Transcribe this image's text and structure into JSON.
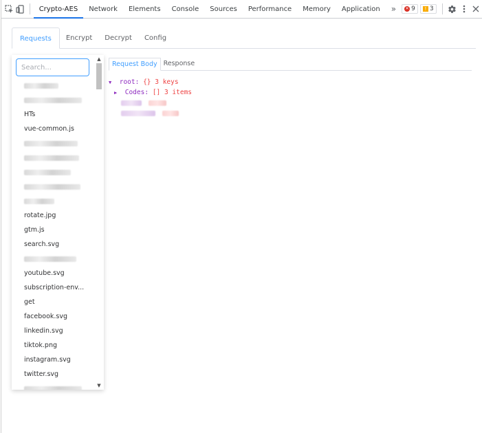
{
  "devtools": {
    "tabs": [
      {
        "label": "Crypto-AES",
        "active": true
      },
      {
        "label": "Network",
        "active": false
      },
      {
        "label": "Elements",
        "active": false
      },
      {
        "label": "Console",
        "active": false
      },
      {
        "label": "Sources",
        "active": false
      },
      {
        "label": "Performance",
        "active": false
      },
      {
        "label": "Memory",
        "active": false
      },
      {
        "label": "Application",
        "active": false
      }
    ],
    "more_tabs": "»",
    "error_count": "9",
    "warning_count": "3"
  },
  "plugin_tabs": [
    {
      "label": "Requests",
      "active": true
    },
    {
      "label": "Encrypt",
      "active": false
    },
    {
      "label": "Decrypt",
      "active": false
    },
    {
      "label": "Config",
      "active": false
    }
  ],
  "search": {
    "placeholder": "Search...",
    "value": ""
  },
  "requests": [
    {
      "label": "",
      "redacted": true
    },
    {
      "label": "",
      "redacted": true
    },
    {
      "label": "HTs",
      "redacted": false
    },
    {
      "label": "vue-common.js",
      "redacted": false
    },
    {
      "label": "",
      "redacted": true
    },
    {
      "label": "",
      "redacted": true
    },
    {
      "label": "",
      "redacted": true
    },
    {
      "label": "",
      "redacted": true
    },
    {
      "label": "",
      "redacted": true
    },
    {
      "label": "rotate.jpg",
      "redacted": false
    },
    {
      "label": "gtm.js",
      "redacted": false
    },
    {
      "label": "search.svg",
      "redacted": false
    },
    {
      "label": "",
      "redacted": true
    },
    {
      "label": "youtube.svg",
      "redacted": false
    },
    {
      "label": "subscription-env...",
      "redacted": false
    },
    {
      "label": "get",
      "redacted": false
    },
    {
      "label": "facebook.svg",
      "redacted": false
    },
    {
      "label": "linkedin.svg",
      "redacted": false
    },
    {
      "label": "tiktok.png",
      "redacted": false
    },
    {
      "label": "instagram.svg",
      "redacted": false
    },
    {
      "label": "twitter.svg",
      "redacted": false
    },
    {
      "label": "",
      "redacted": true
    }
  ],
  "detail_tabs": [
    {
      "label": "Request Body",
      "active": true
    },
    {
      "label": "Response",
      "active": false
    }
  ],
  "tree": {
    "root_key": "root:",
    "root_type": "{}",
    "root_count": "3 keys",
    "child_key": "Codes:",
    "child_type": "[]",
    "child_count": "3 items"
  },
  "colors": {
    "accent": "#409eff",
    "tree_key": "#8e2bbf",
    "tree_value": "#ee4444"
  }
}
